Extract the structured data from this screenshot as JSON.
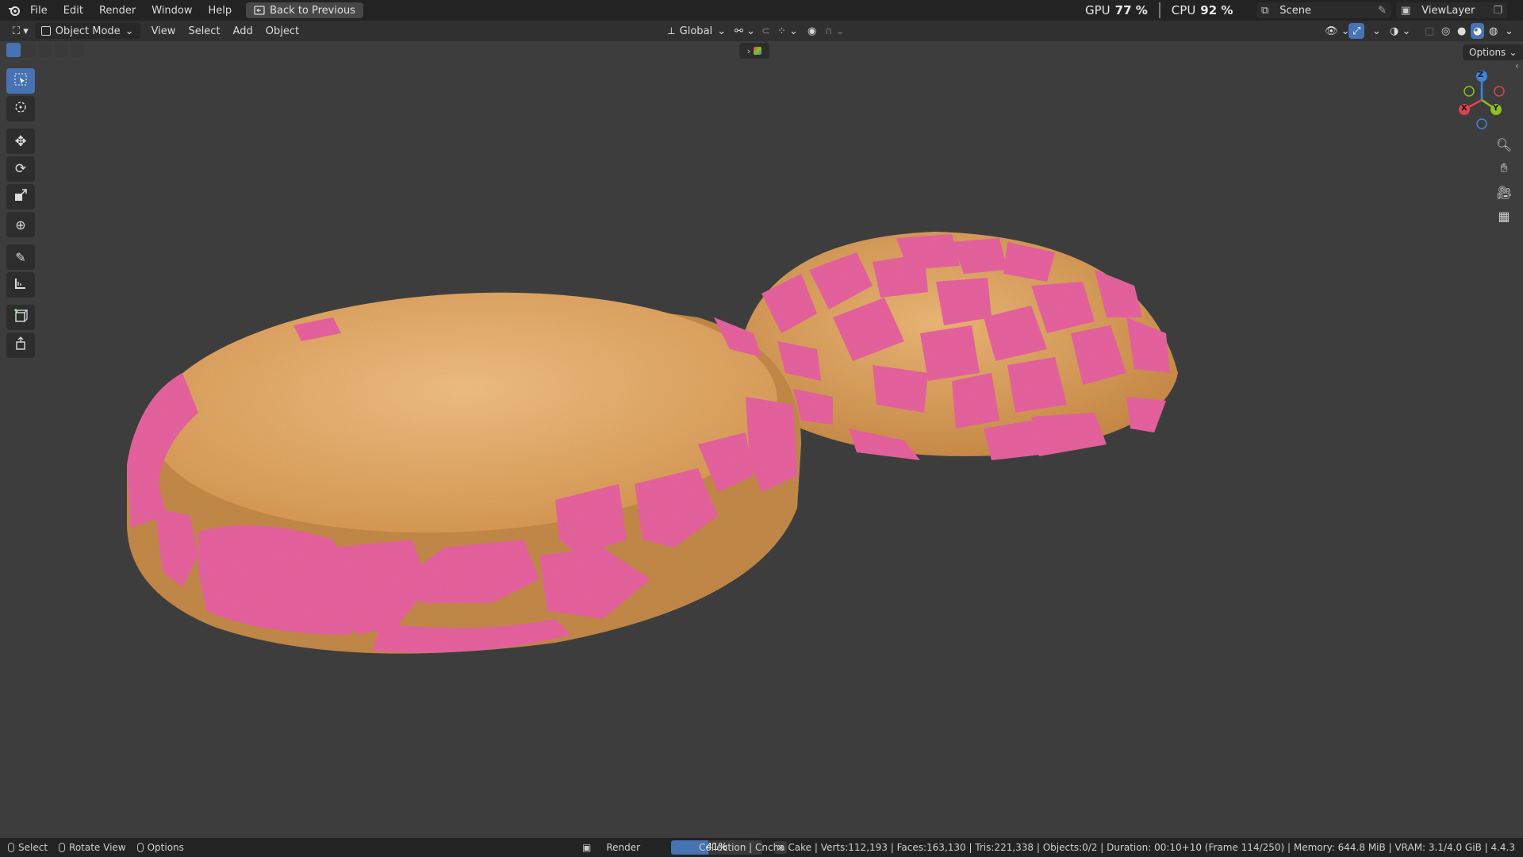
{
  "topbar": {
    "menus": [
      "File",
      "Edit",
      "Render",
      "Window",
      "Help"
    ],
    "back_button": "Back to Previous",
    "gpu_label": "GPU",
    "gpu_value": "77 %",
    "cpu_label": "CPU",
    "cpu_value": "92 %",
    "scene_name": "Scene",
    "view_layer_name": "ViewLayer"
  },
  "header": {
    "mode": "Object Mode",
    "menus": [
      "View",
      "Select",
      "Add",
      "Object"
    ],
    "transform_orientation": "Global",
    "options_label": "Options"
  },
  "toolbar": {
    "tools": [
      "select-box-icon",
      "cursor-icon",
      "move-icon",
      "rotate-icon",
      "scale-icon",
      "transform-icon",
      "annotate-icon",
      "measure-icon",
      "add-cube-icon",
      "extrude-icon"
    ],
    "active_tool": "select-box-icon"
  },
  "gizmo": {
    "x_label": "X",
    "y_label": "Y",
    "z_label": "Z",
    "colors": {
      "x": "#e0434f",
      "y": "#8cc21d",
      "z": "#3a86e0"
    }
  },
  "navigation": [
    "zoom-icon",
    "pan-hand-icon",
    "camera-icon",
    "grid-icon"
  ],
  "statusbar": {
    "select_label": "Select",
    "rotate_label": "Rotate View",
    "options_label": "Options",
    "render_label": "Render",
    "progress_percent": 41,
    "progress_text": "41%",
    "info": "Collection | Cncha Cake | Verts:112,193 | Faces:163,130 | Tris:221,338 | Objects:0/2 | Duration: 00:10+10 (Frame 114/250) | Memory: 644.8 MiB | VRAM: 3.1/4.0 GiB | 4.4.3"
  },
  "colors": {
    "accent": "#4772b3",
    "viewport_bg": "#3d3d3d",
    "topping_pink": "#e8639f",
    "bread_tan": "#e4aa6a"
  }
}
